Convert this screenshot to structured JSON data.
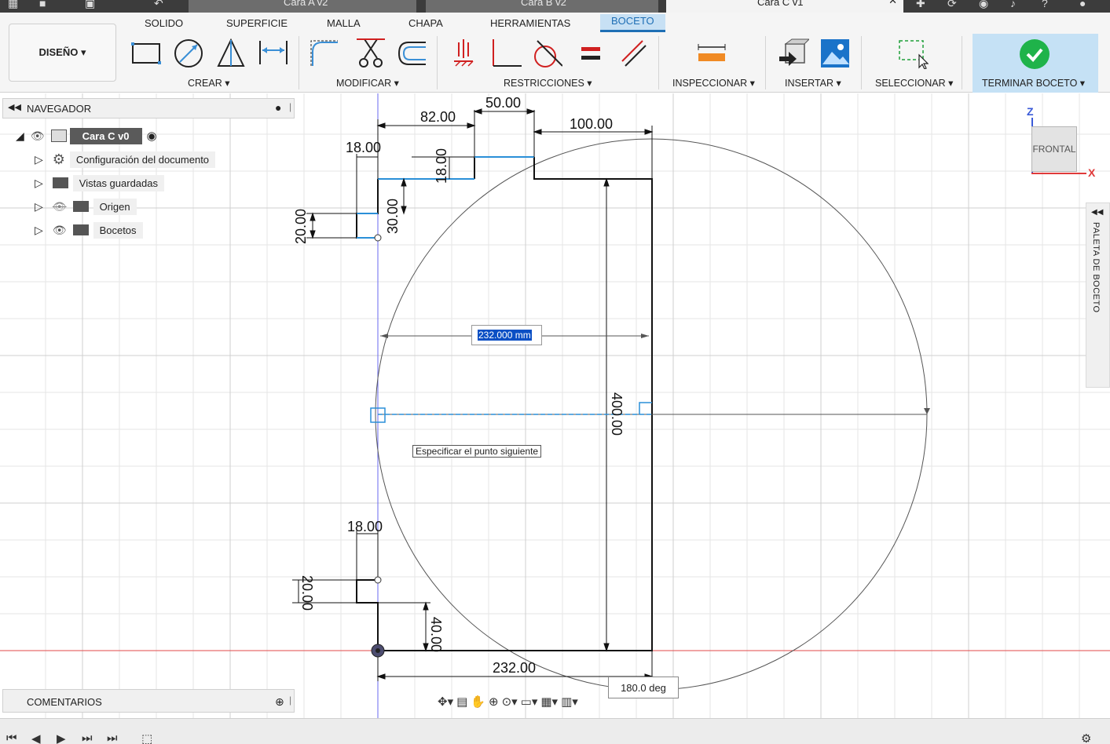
{
  "doc_tabs": [
    {
      "label": "Cara A v2"
    },
    {
      "label": "Cara B v2"
    },
    {
      "label": "Cara C v1"
    }
  ],
  "ribbon": {
    "tabs": [
      "SOLIDO",
      "SUPERFICIE",
      "MALLA",
      "CHAPA",
      "HERRAMIENTAS",
      "BOCETO"
    ],
    "active_tab": "BOCETO",
    "workspace": "DISEÑO ▾",
    "groups": [
      "CREAR ▾",
      "MODIFICAR ▾",
      "RESTRICCIONES ▾",
      "INSPECCIONAR ▾",
      "INSERTAR ▾",
      "SELECCIONAR ▾",
      "TERMINAR BOCETO ▾"
    ]
  },
  "navigator": {
    "title": "NAVEGADOR",
    "root": "Cara C v0",
    "items": [
      "Configuración del documento",
      "Vistas guardadas",
      "Origen",
      "Bocetos"
    ]
  },
  "comments": {
    "title": "COMENTARIOS"
  },
  "palette": {
    "title": "PALETA DE BOCETO"
  },
  "viewcube": {
    "face": "FRONTAL",
    "axis_z": "Z",
    "axis_x": "X"
  },
  "sketch": {
    "dimensions": {
      "d82": "82.00",
      "d50": "50.00",
      "d100": "100.00",
      "d18_top": "18.00",
      "d18_vert": "18.00",
      "d30": "30.00",
      "d20_top": "20.00",
      "d400": "400.00",
      "d18_bottom": "18.00",
      "d20_bottom": "20.00",
      "d40": "40.00",
      "d232": "232.00"
    },
    "input_value": "232.000 mm",
    "hint": "Especificar el punto siguiente",
    "angle": "180.0 deg"
  }
}
